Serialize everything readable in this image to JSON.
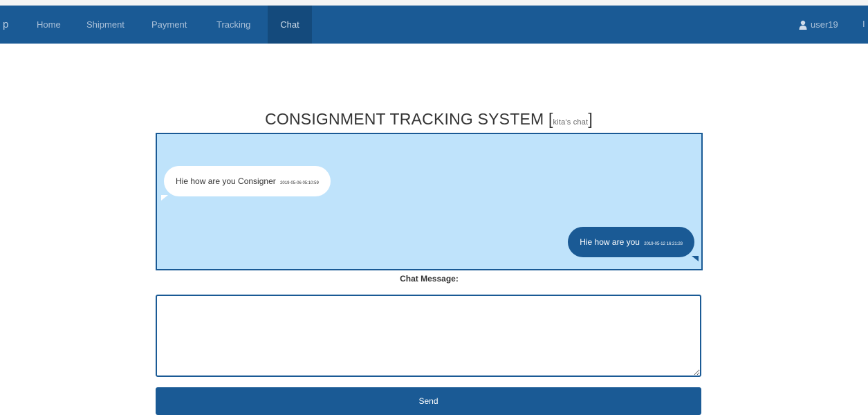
{
  "nav": {
    "brand_fragment": "p",
    "items": [
      {
        "label": "Home",
        "active": false
      },
      {
        "label": "Shipment",
        "active": false
      },
      {
        "label": "Payment",
        "active": false
      },
      {
        "label": "Tracking",
        "active": false
      },
      {
        "label": "Chat",
        "active": true
      }
    ],
    "user_label": "user19",
    "edge_fragment": "I"
  },
  "page": {
    "title": "CONSIGNMENT TRACKING SYSTEM",
    "subtitle_open": "[",
    "subtitle": "kita's chat",
    "subtitle_close": "]"
  },
  "chat": {
    "messages": [
      {
        "side": "left",
        "text": "Hie how are you Consigner",
        "time": "2019-05-06 05:10:59"
      },
      {
        "side": "right",
        "text": "Hie how are you",
        "time": "2019-05-12 16:21:28"
      }
    ]
  },
  "form": {
    "label": "Chat Message:",
    "value": "",
    "send_label": "Send"
  },
  "colors": {
    "navbar": "#1a5a95",
    "chat_background": "#bfe3fb",
    "own_bubble": "#1a5a95",
    "other_bubble": "#ffffff"
  }
}
